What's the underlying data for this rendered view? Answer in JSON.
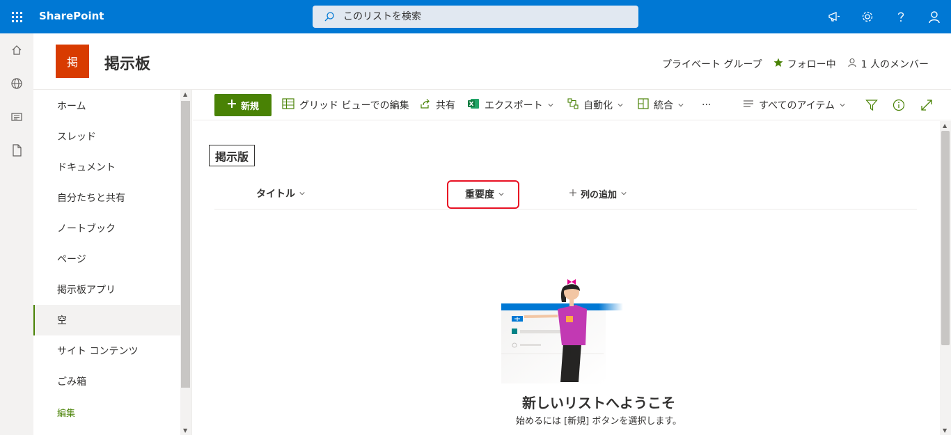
{
  "suite": {
    "brand": "SharePoint",
    "search_placeholder": "このリストを検索",
    "icons": [
      "megaphone-icon",
      "gear-icon",
      "help-icon",
      "person-icon"
    ]
  },
  "rail": {
    "icons": [
      "home-icon",
      "globe-icon",
      "news-icon",
      "document-icon"
    ]
  },
  "site": {
    "logo_char": "掲",
    "logo_color": "#d83b01",
    "title": "掲示板",
    "group_type": "プライベート グループ",
    "follow_label": "フォロー中",
    "members_label": "1 人のメンバー"
  },
  "nav": {
    "items": [
      {
        "label": "ホーム"
      },
      {
        "label": "スレッド"
      },
      {
        "label": "ドキュメント"
      },
      {
        "label": "自分たちと共有"
      },
      {
        "label": "ノートブック"
      },
      {
        "label": "ページ"
      },
      {
        "label": "掲示板アプリ"
      },
      {
        "label": "空",
        "selected": true
      },
      {
        "label": "サイト コンテンツ"
      },
      {
        "label": "ごみ箱"
      },
      {
        "label": "編集"
      }
    ]
  },
  "commands": {
    "new": "新規",
    "grid_edit": "グリッド ビューでの編集",
    "share": "共有",
    "export": "エクスポート",
    "automate": "自動化",
    "integrate": "統合",
    "more": "···",
    "view": "すべてのアイテム"
  },
  "list": {
    "title": "掲示版",
    "columns": [
      "タイトル",
      "重要度"
    ],
    "add_column": "列の追加",
    "empty_title": "新しいリストへようこそ",
    "empty_sub": "始めるには [新規] ボタンを選択します。"
  },
  "colors": {
    "suite": "#0078d4",
    "accent": "#498205",
    "highlight": "#e81123"
  }
}
